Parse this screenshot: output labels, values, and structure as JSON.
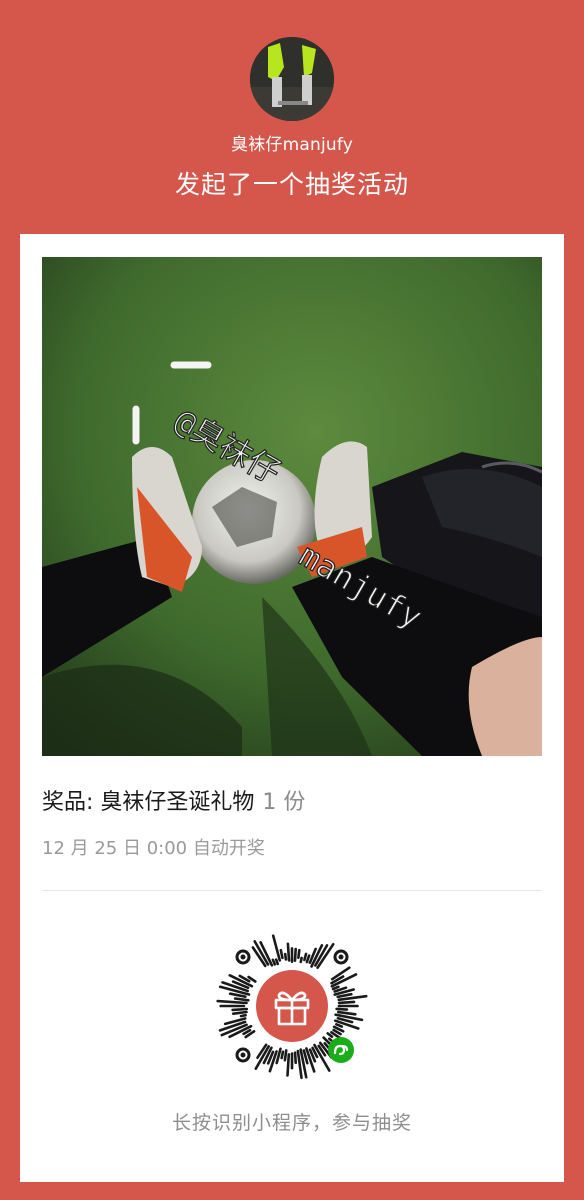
{
  "header": {
    "username": "臭袜仔manjufy",
    "headline": "发起了一个抽奖活动"
  },
  "photo": {
    "watermark_line1": "@臭袜仔",
    "watermark_line2": "manjufy"
  },
  "prize": {
    "label": "奖品: 臭袜仔圣诞礼物",
    "count": "1 份"
  },
  "draw_time": "12 月 25 日 0:00 自动开奖",
  "footer": {
    "hint": "长按识别小程序，参与抽奖"
  },
  "colors": {
    "background": "#d5574c",
    "card": "#ffffff",
    "accent": "#d5574c",
    "wechat_green": "#1aad19"
  },
  "icons": [
    "gift-icon",
    "mini-program-icon"
  ]
}
